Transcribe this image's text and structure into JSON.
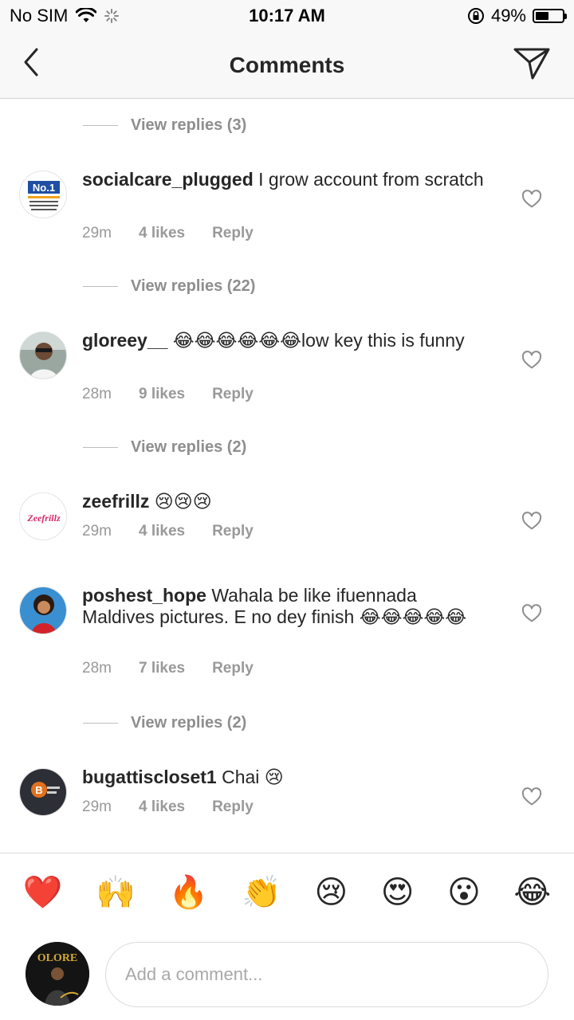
{
  "status_bar": {
    "carrier": "No SIM",
    "time": "10:17 AM",
    "battery": "49%",
    "battery_level": 0.49
  },
  "header": {
    "title": "Comments"
  },
  "thread": [
    {
      "view_replies": "View replies (3)"
    },
    {
      "username": "socialcare_plugged",
      "text": "I grow account from scratch",
      "time": "29m",
      "likes": "4 likes",
      "reply": "Reply",
      "avatar_text": "No.1"
    },
    {
      "view_replies": "View replies (22)"
    },
    {
      "username": "gloreey__",
      "text": "😂😂😂😂😂😂low key this is funny",
      "time": "28m",
      "likes": "9 likes",
      "reply": "Reply"
    },
    {
      "view_replies": "View replies (2)"
    },
    {
      "username": "zeefrillz",
      "text": "😢😢😢",
      "time": "29m",
      "likes": "4 likes",
      "reply": "Reply",
      "avatar_text": "Zeefrillz"
    },
    {
      "username": "poshest_hope",
      "text": "Wahala be like ifuennada Maldives pictures. E no dey finish 😂😂😂😂😂",
      "time": "28m",
      "likes": "7 likes",
      "reply": "Reply"
    },
    {
      "view_replies": "View replies (2)"
    },
    {
      "username": "bugattiscloset1",
      "text": "Chai 😢",
      "time": "29m",
      "likes": "4 likes",
      "reply": "Reply"
    }
  ],
  "quick_reactions": [
    "❤️",
    "🙌",
    "🔥",
    "👏",
    "😢",
    "😍",
    "😮",
    "😂"
  ],
  "composer": {
    "placeholder": "Add a comment...",
    "avatar_text": "OLORE"
  },
  "colors": {
    "text": "#262626",
    "muted": "#8e8e8e",
    "border": "#dbdbdb"
  }
}
